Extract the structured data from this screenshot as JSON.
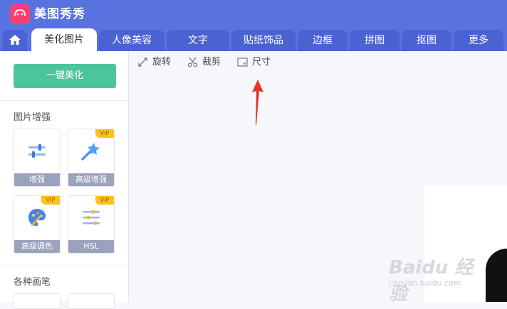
{
  "app": {
    "title": "美图秀秀"
  },
  "tabs": [
    {
      "label": "美化图片",
      "active": true
    },
    {
      "label": "人像美容"
    },
    {
      "label": "文字"
    },
    {
      "label": "贴纸饰品"
    },
    {
      "label": "边框"
    },
    {
      "label": "拼图"
    },
    {
      "label": "抠图"
    },
    {
      "label": "更多"
    }
  ],
  "toolbar": {
    "rotate": "旋转",
    "crop": "裁剪",
    "size": "尺寸"
  },
  "sidebar": {
    "one_click": "一键美化",
    "section_enhance": "图片增强",
    "section_brush": "各种画笔",
    "tools": [
      {
        "label": "增强",
        "icon": "sliders-icon",
        "vip": false
      },
      {
        "label": "高级增强",
        "icon": "magic-wand-icon",
        "vip": true,
        "badge": "VIP"
      },
      {
        "label": "高级调色",
        "icon": "palette-icon",
        "vip": true,
        "badge": "VIP"
      },
      {
        "label": "HSL",
        "icon": "hsl-sliders-icon",
        "vip": true,
        "badge": "VIP"
      }
    ]
  },
  "watermark": {
    "brand": "Baidu 经验",
    "url": "jingyan.baidu.com"
  },
  "colors": {
    "primary": "#5872e0",
    "tab": "#4b63d2",
    "green": "#4ac69a",
    "vip": "#ffc21a",
    "arrow": "#e8312a"
  }
}
